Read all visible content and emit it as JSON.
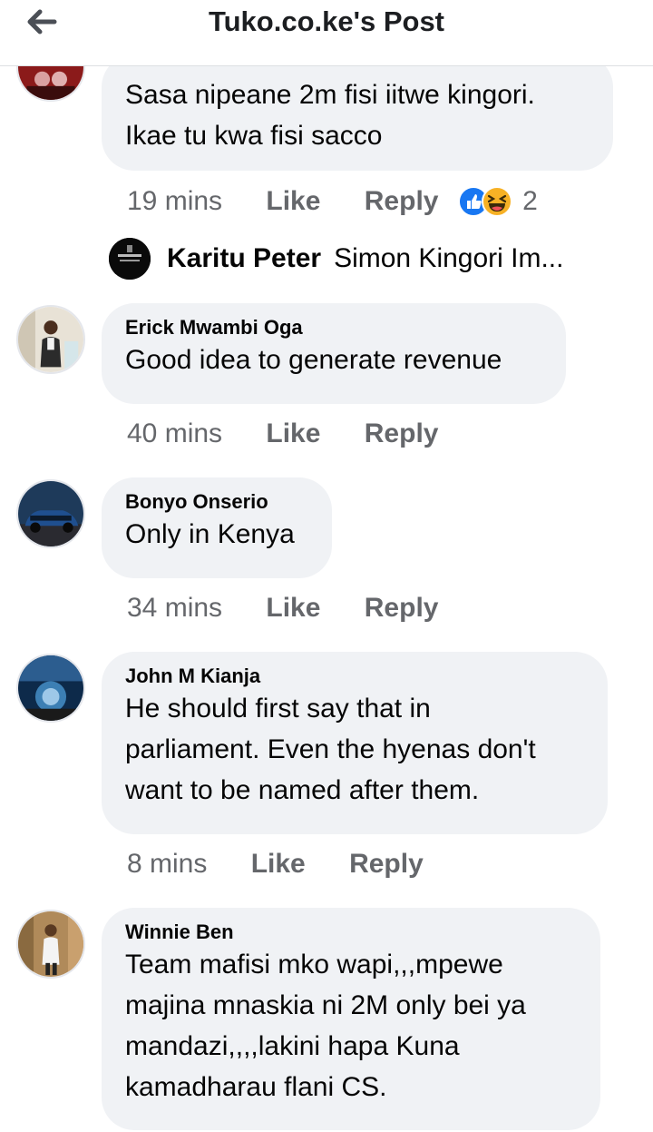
{
  "header": {
    "title": "Tuko.co.ke's Post",
    "back_icon": "arrow-left-icon"
  },
  "first_comment": {
    "lines": [
      "Sasa nipeane 2m fisi iitwe kingori.",
      "Ikae tu kwa fisi sacco"
    ],
    "time": "19 mins",
    "like": "Like",
    "reply": "Reply",
    "reaction_count": "2",
    "reaction_icons": [
      "like-reaction-icon",
      "haha-reaction-icon"
    ]
  },
  "reply_preview": {
    "author": "Karitu Peter",
    "text": "Simon Kingori Im..."
  },
  "comments": [
    {
      "author": "Erick Mwambi Oga",
      "lines": [
        "Good idea to generate revenue"
      ],
      "time": "40 mins",
      "like": "Like",
      "reply": "Reply"
    },
    {
      "author": "Bonyo Onserio",
      "lines": [
        "Only in Kenya"
      ],
      "time": "34 mins",
      "like": "Like",
      "reply": "Reply"
    },
    {
      "author": "John M Kianja",
      "lines": [
        "He should first say that in",
        "parliament. Even the hyenas don't",
        "want to be named after them."
      ],
      "time": "8 mins",
      "like": "Like",
      "reply": "Reply"
    },
    {
      "author": "Winnie Ben",
      "lines": [
        "Team mafisi mko wapi,,,mpewe",
        "majina mnaskia ni 2M only bei ya",
        "mandazi,,,,lakini hapa Kuna",
        "kamadharau flani CS."
      ]
    }
  ]
}
